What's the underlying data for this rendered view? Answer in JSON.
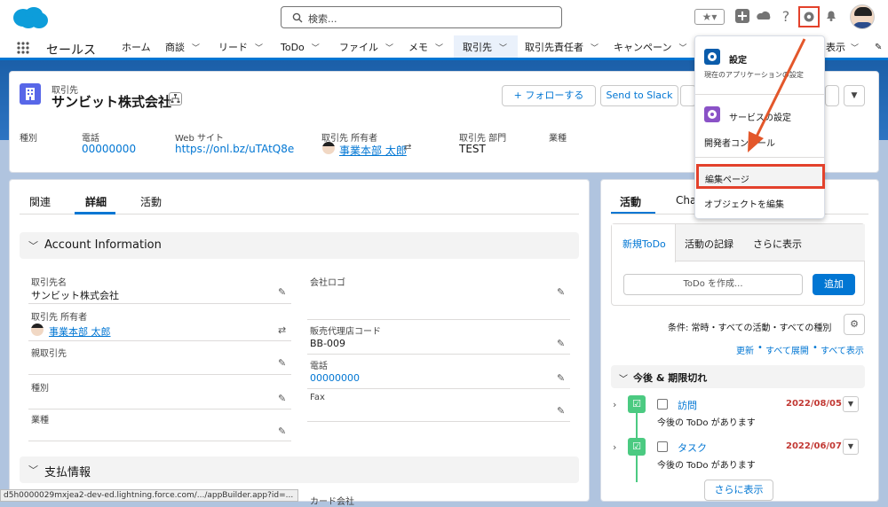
{
  "header": {
    "search_placeholder": "検索...",
    "brand_color": "#0176d3"
  },
  "nav": {
    "app_name": "セールス",
    "items": [
      {
        "label": "ホーム"
      },
      {
        "label": "商談"
      },
      {
        "label": "リード"
      },
      {
        "label": "ToDo"
      },
      {
        "label": "ファイル"
      },
      {
        "label": "メモ"
      },
      {
        "label": "取引先"
      },
      {
        "label": "取引先責任者"
      },
      {
        "label": "キャンペーン"
      }
    ],
    "overflow_label": "表示"
  },
  "record": {
    "object_label": "取引先",
    "title": "サンビット株式会社",
    "follow_label": "+ フォローする",
    "slack_label": "Send to Slack",
    "highlights": [
      {
        "label": "種別",
        "value": ""
      },
      {
        "label": "電話",
        "value": "00000000"
      },
      {
        "label": "Web サイト",
        "value": "https://onl.bz/uTAtQ8e"
      },
      {
        "label": "取引先 所有者",
        "value": "事業本部 太郎"
      },
      {
        "label": "取引先 部門",
        "value": "TEST"
      },
      {
        "label": "業種",
        "value": ""
      }
    ]
  },
  "detail": {
    "tabs": [
      "関連",
      "詳細",
      "活動"
    ],
    "section1": "Account Information",
    "fields_left": [
      {
        "label": "取引先名",
        "value": "サンビット株式会社"
      },
      {
        "label": "取引先 所有者",
        "value": "事業本部 太郎"
      },
      {
        "label": "親取引先",
        "value": ""
      },
      {
        "label": "種別",
        "value": ""
      },
      {
        "label": "業種",
        "value": ""
      }
    ],
    "fields_right": [
      {
        "label": "会社ロゴ",
        "value": ""
      },
      {
        "label": "販売代理店コード",
        "value": "BB-009"
      },
      {
        "label": "電話",
        "value": "00000000"
      },
      {
        "label": "Fax",
        "value": ""
      }
    ],
    "section2": "支払情報",
    "cut_label": "カード会社"
  },
  "activity": {
    "tabs": [
      "活動",
      "Cha"
    ],
    "subtabs": [
      "新規ToDo",
      "活動の記録",
      "さらに表示"
    ],
    "todo_placeholder": "ToDo を作成...",
    "add_label": "追加",
    "filter_text": "条件: 常時・すべての活動・すべての種別",
    "links": [
      "更新",
      "すべて展開",
      "すべて表示"
    ],
    "upcoming_label": "今後 & 期限切れ",
    "items": [
      {
        "title": "訪問",
        "date": "2022/08/05",
        "sub": "今後の ToDo があります"
      },
      {
        "title": "タスク",
        "date": "2022/06/07",
        "sub": "今後の ToDo があります"
      }
    ],
    "more_label": "さらに表示"
  },
  "menu": {
    "setup": "設定",
    "setup_sub": "現在のアプリケーションの設定",
    "service_setup": "サービスの設定",
    "dev_console": "開発者コンソール",
    "edit_page": "編集ページ",
    "edit_object": "オブジェクトを編集"
  },
  "status_url": "d5h0000029mxjea2-dev-ed.lightning.force.com/.../appBuilder.app?id=..."
}
